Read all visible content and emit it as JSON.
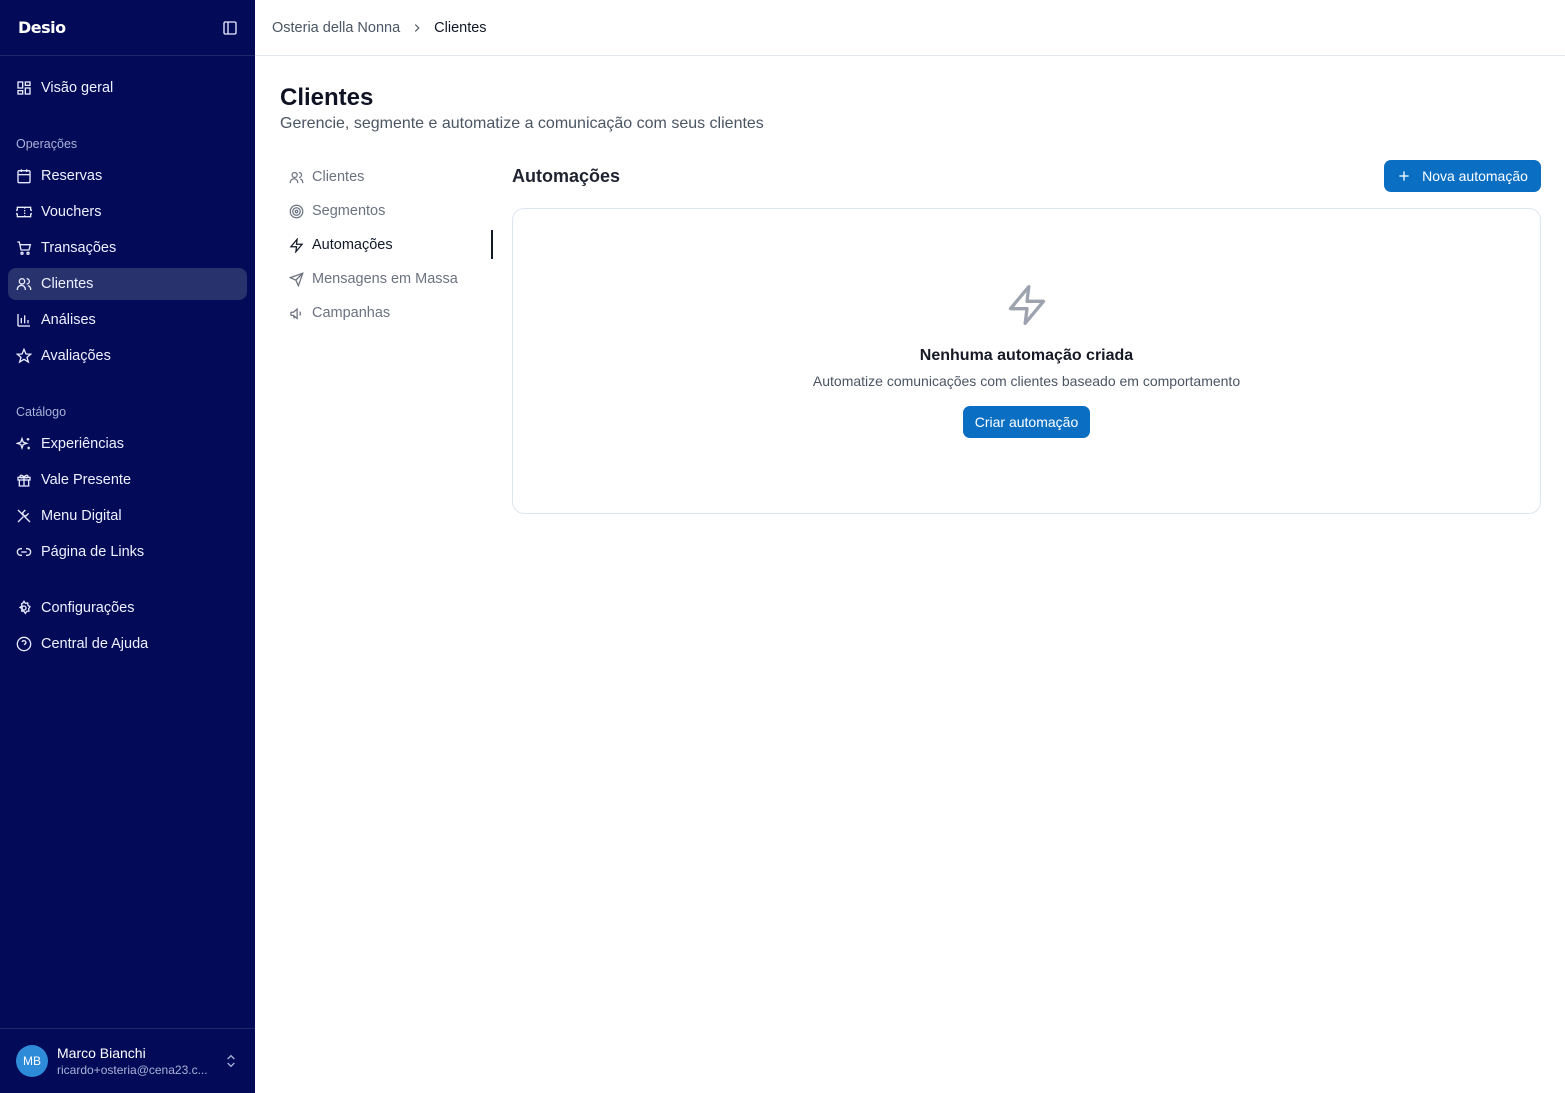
{
  "brand": {
    "logo_text": "Desio"
  },
  "sidebar": {
    "overview": {
      "label": "Visão geral",
      "icon": "dashboard-icon"
    },
    "sections": [
      {
        "label": "Operações",
        "items": [
          {
            "label": "Reservas",
            "icon": "calendar-icon"
          },
          {
            "label": "Vouchers",
            "icon": "ticket-icon"
          },
          {
            "label": "Transações",
            "icon": "cart-icon"
          },
          {
            "label": "Clientes",
            "icon": "users-icon",
            "active": true
          },
          {
            "label": "Análises",
            "icon": "bar-chart-icon"
          },
          {
            "label": "Avaliações",
            "icon": "star-icon"
          }
        ]
      },
      {
        "label": "Catálogo",
        "items": [
          {
            "label": "Experiências",
            "icon": "sparkles-icon"
          },
          {
            "label": "Vale Presente",
            "icon": "gift-icon"
          },
          {
            "label": "Menu Digital",
            "icon": "utensils-icon"
          },
          {
            "label": "Página de Links",
            "icon": "link-icon"
          }
        ]
      }
    ],
    "bottom_items": [
      {
        "label": "Configurações",
        "icon": "gear-icon"
      },
      {
        "label": "Central de Ajuda",
        "icon": "help-circle-icon"
      }
    ],
    "user": {
      "initials": "MB",
      "name": "Marco Bianchi",
      "email": "ricardo+osteria@cena23.c..."
    }
  },
  "breadcrumb": {
    "parent": "Osteria della Nonna",
    "current": "Clientes"
  },
  "page": {
    "title": "Clientes",
    "subtitle": "Gerencie, segmente e automatize a comunicação com seus clientes"
  },
  "subnav": [
    {
      "label": "Clientes",
      "icon": "users-icon"
    },
    {
      "label": "Segmentos",
      "icon": "target-icon"
    },
    {
      "label": "Automações",
      "icon": "zap-icon",
      "active": true
    },
    {
      "label": "Mensagens em Massa",
      "icon": "send-icon"
    },
    {
      "label": "Campanhas",
      "icon": "megaphone-icon"
    }
  ],
  "automations": {
    "title": "Automações",
    "new_button": "Nova automação",
    "empty": {
      "title": "Nenhuma automação criada",
      "description": "Automatize comunicações com clientes baseado em comportamento",
      "cta": "Criar automação"
    }
  },
  "colors": {
    "sidebar_bg": "#030a57",
    "sidebar_active": "#28336e",
    "primary": "#0a6fc2",
    "avatar": "#2e8bd8"
  }
}
